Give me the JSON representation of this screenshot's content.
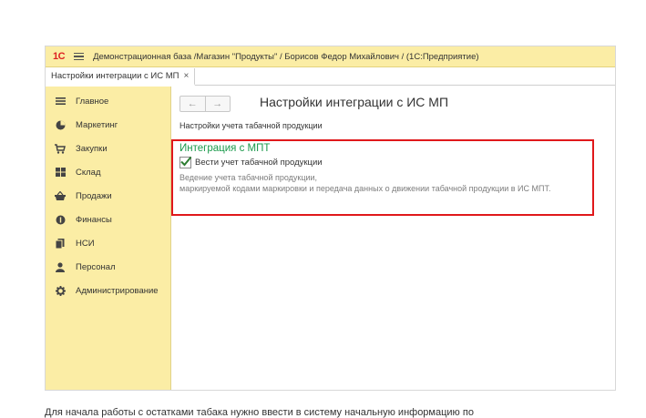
{
  "window": {
    "logo": "1С",
    "title": "Демонстрационная база /Магазин \"Продукты\" / Борисов Федор Михайлович /  (1С:Предприятие)"
  },
  "tabs": [
    {
      "label": "Настройки интеграции с ИС МП",
      "close": "×"
    }
  ],
  "sidebar": {
    "items": [
      {
        "label": "Главное",
        "icon": "menu-lines-icon"
      },
      {
        "label": "Маркетинг",
        "icon": "pie-chart-icon"
      },
      {
        "label": "Закупки",
        "icon": "cart-icon"
      },
      {
        "label": "Склад",
        "icon": "warehouse-icon"
      },
      {
        "label": "Продажи",
        "icon": "basket-icon"
      },
      {
        "label": "Финансы",
        "icon": "coin-icon"
      },
      {
        "label": "НСИ",
        "icon": "documents-icon"
      },
      {
        "label": "Персонал",
        "icon": "person-icon"
      },
      {
        "label": "Администрирование",
        "icon": "gear-icon"
      }
    ]
  },
  "content": {
    "nav_back": "←",
    "nav_forward": "→",
    "page_title": "Настройки интеграции с ИС МП",
    "section_label": "Настройки учета табачной продукции",
    "group_title": "Интеграция с МПТ",
    "checkbox_label": "Вести учет табачной продукции",
    "checkbox_checked": true,
    "description_line1": "Ведение учета табачной продукции,",
    "description_line2": "маркируемой кодами маркировки и передача данных о движении табачной продукции в ИС МПТ."
  },
  "colors": {
    "sidebar_bg": "#fbeda5",
    "group_title": "#1a9a4b",
    "highlight_border": "#e0181b"
  },
  "footer_text": "Для начала работы с остатками табака нужно ввести в систему начальную информацию по"
}
